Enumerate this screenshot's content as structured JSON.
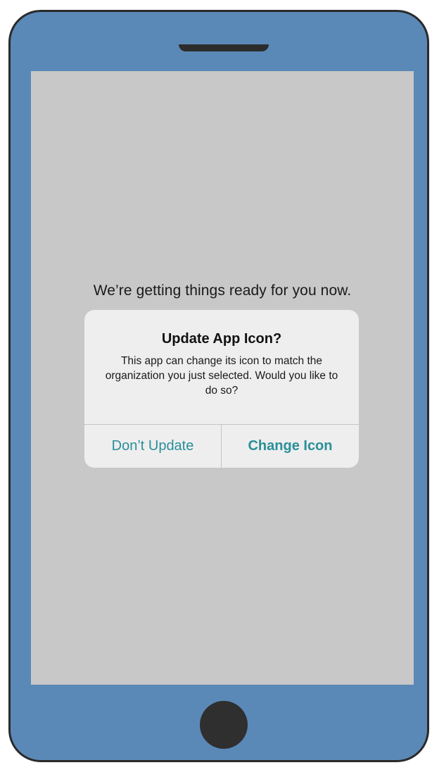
{
  "screen": {
    "status_text": "We’re getting things ready for you now."
  },
  "alert": {
    "title": "Update App Icon?",
    "message": "This app can change its icon to match the organization you just selected. Would you like to do so?",
    "buttons": [
      {
        "label": "Don’t Update"
      },
      {
        "label": "Change Icon"
      }
    ]
  },
  "colors": {
    "device_frame": "#5b89b7",
    "screen_background": "#c8c8c8",
    "alert_background": "#eeeeef",
    "button_tint": "#2a8f98"
  }
}
